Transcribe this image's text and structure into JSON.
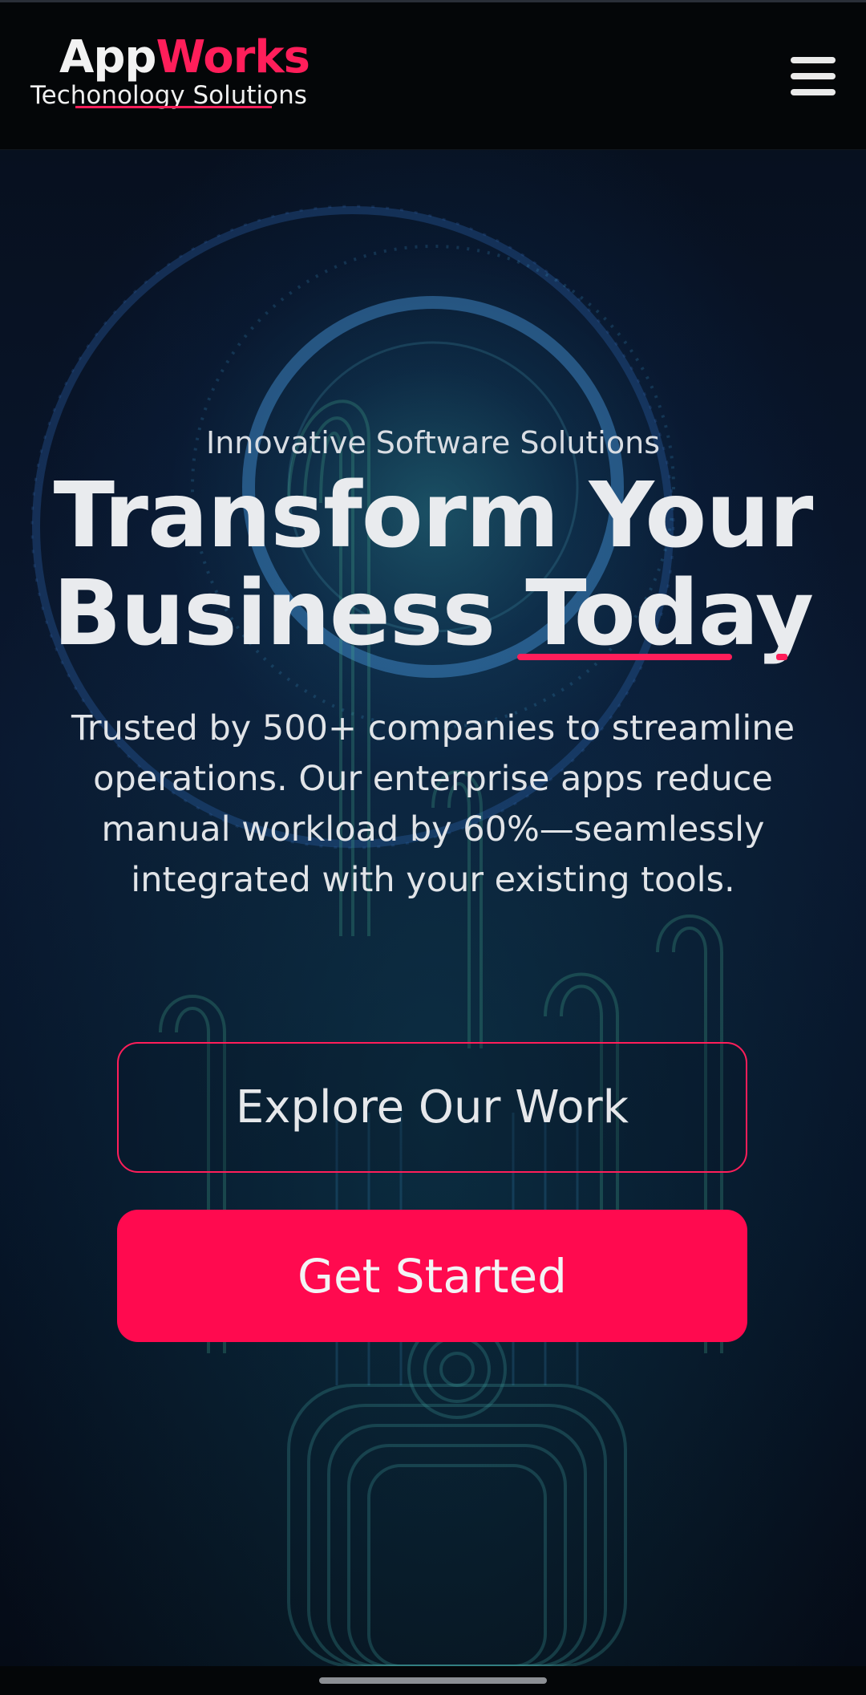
{
  "header": {
    "logo_name_part1": "App",
    "logo_name_part2": "Works",
    "logo_tagline": "Techonology Solutions",
    "menu_icon": "hamburger-menu-icon"
  },
  "hero": {
    "subtitle": "Innovative Software Solutions",
    "title_line1": "Transform Your",
    "title_line2": "Business Today",
    "description": "Trusted by 500+ companies to streamline operations. Our enterprise apps reduce manual workload by 60%—seamlessly integrated with your existing tools.",
    "secondary_button": "Explore Our Work",
    "primary_button": "Get Started",
    "background_image": "digital-fingerprint-hand-illustration"
  },
  "colors": {
    "accent": "#ff1e5a",
    "primary_button": "#ff0a4f",
    "background": "#07101f",
    "text": "#e9ebee"
  }
}
